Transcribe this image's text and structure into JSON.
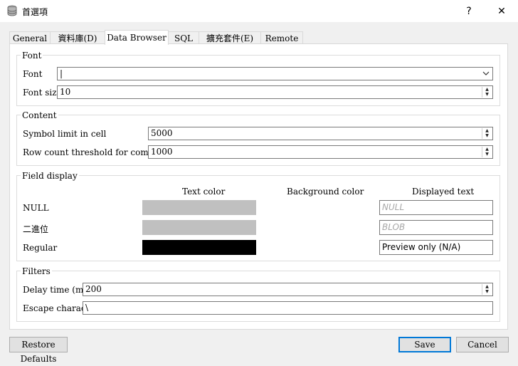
{
  "window": {
    "title": "首選項",
    "help_glyph": "?",
    "close_glyph": "✕"
  },
  "tabs": [
    {
      "label": "General"
    },
    {
      "label": "資料庫(D)"
    },
    {
      "label": "Data Browser"
    },
    {
      "label": "SQL"
    },
    {
      "label": "擴充套件(E)"
    },
    {
      "label": "Remote"
    }
  ],
  "font_group": {
    "title": "Font",
    "font_label": "Font",
    "font_value": "|",
    "font_size_label": "Font size",
    "font_size_value": "10"
  },
  "content_group": {
    "title": "Content",
    "symbol_limit_label": "Symbol limit in cell",
    "symbol_limit_value": "5000",
    "row_count_label": "Row count threshold for completion",
    "row_count_value": "1000"
  },
  "field_display": {
    "title": "Field display",
    "col_text_color": "Text color",
    "col_background_color": "Background color",
    "col_displayed_text": "Displayed text",
    "rows": [
      {
        "label": "NULL",
        "text_color": "#c0c0c0",
        "placeholder": "NULL",
        "value": ""
      },
      {
        "label": "二進位",
        "text_color": "#c0c0c0",
        "placeholder": "BLOB",
        "value": ""
      },
      {
        "label": "Regular",
        "text_color": "#000000",
        "placeholder": "",
        "value": "Preview only (N/A)"
      }
    ]
  },
  "filters_group": {
    "title": "Filters",
    "delay_label": "Delay time (ms)",
    "delay_value": "200",
    "escape_label": "Escape character",
    "escape_value": "\\"
  },
  "buttons": {
    "restore_defaults": "Restore Defaults",
    "save": "Save",
    "cancel": "Cancel"
  },
  "colors": {
    "accent": "#0078d7"
  }
}
